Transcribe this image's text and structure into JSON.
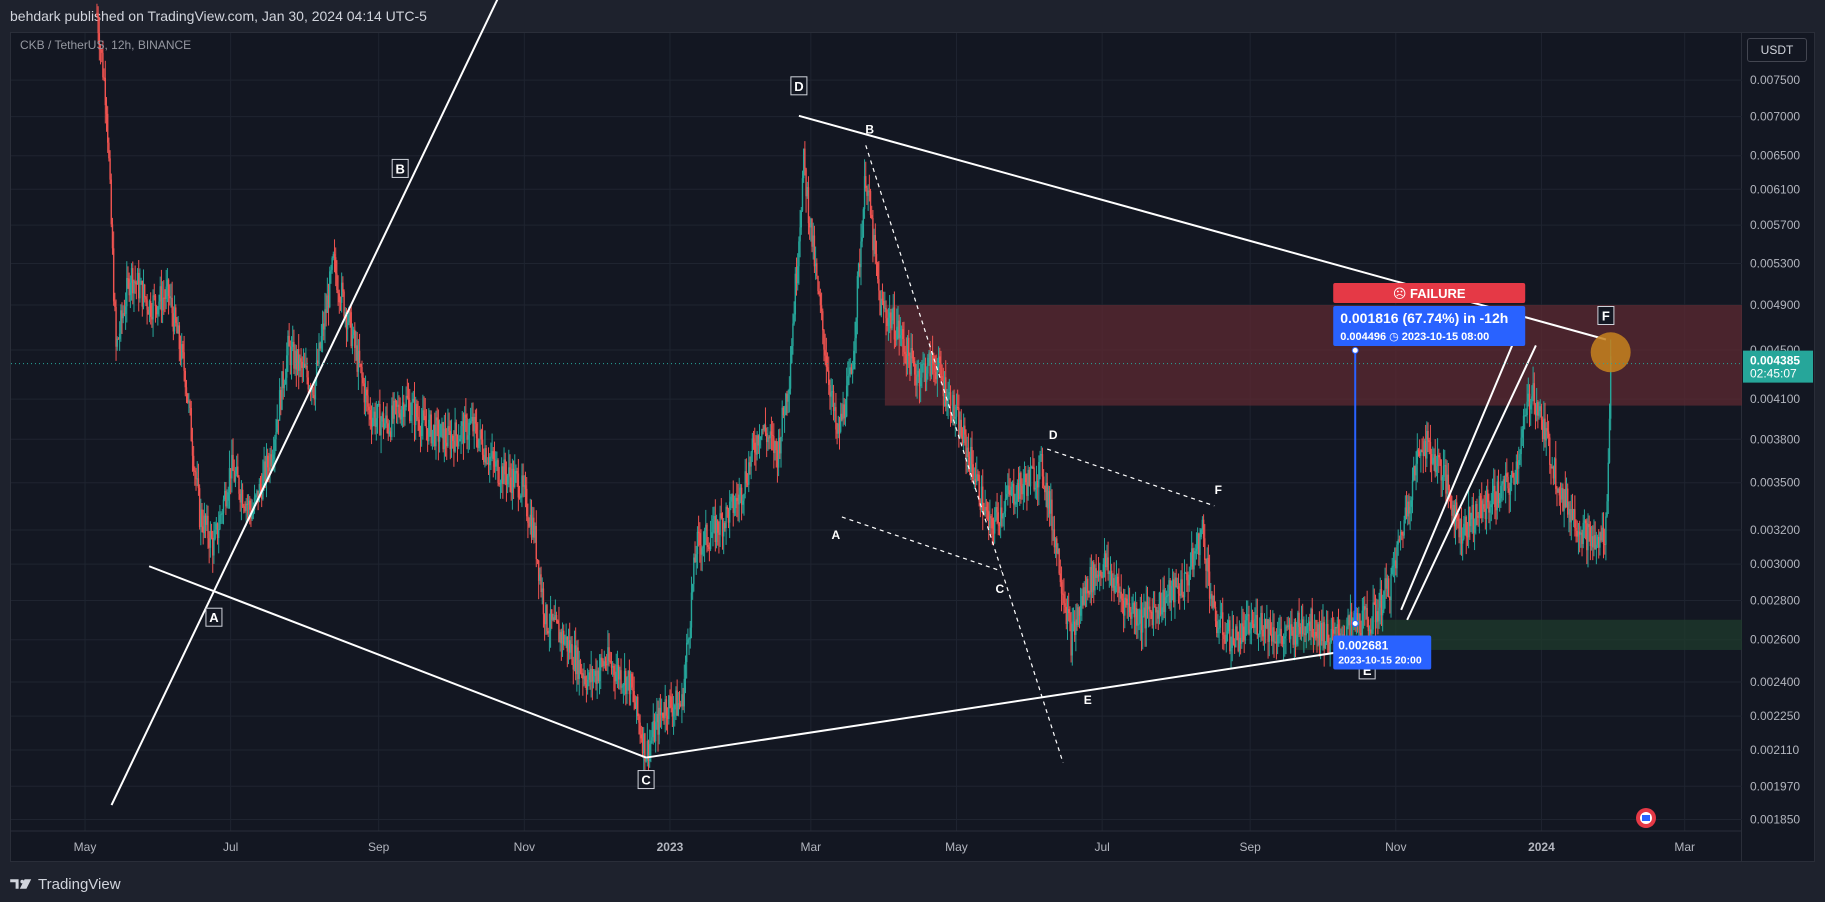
{
  "header": {
    "published_text": "behdark published on TradingView.com, Jan 30, 2024 04:14 UTC-5"
  },
  "footer": {
    "brand": "TradingView"
  },
  "symbol": {
    "label": "CKB / TetherUS, 12h, BINANCE",
    "currency": "USDT"
  },
  "colors": {
    "background": "#131722",
    "up_candle": "#26a69a",
    "down_candle": "#ef5350",
    "pattern_line": "#ffffff",
    "resistance_zone": "#5d2a32",
    "support_zone": "#1f3b2c",
    "measure_blue": "#2962ff",
    "failure_red": "#e53946",
    "current_price_bg": "#26a69a",
    "marker_orange": "#c7821e"
  },
  "chart_data": {
    "type": "candlestick",
    "symbol": "CKB / TetherUS",
    "interval": "12h",
    "exchange": "BINANCE",
    "x_ticks": [
      "May",
      "Jul",
      "Sep",
      "Nov",
      "2023",
      "Mar",
      "May",
      "Jul",
      "Sep",
      "Nov",
      "2024",
      "Mar"
    ],
    "y_ticks": [
      "0.007500",
      "0.007000",
      "0.006500",
      "0.006100",
      "0.005700",
      "0.005300",
      "0.004900",
      "0.004500",
      "0.004100",
      "0.003800",
      "0.003500",
      "0.003200",
      "0.003000",
      "0.002800",
      "0.002600",
      "0.002400",
      "0.002250",
      "0.002110",
      "0.001970",
      "0.001850"
    ],
    "log_scale": true,
    "current_price": "0.004385",
    "countdown": "02:45:07",
    "price_series": {
      "name": "CKB/USDT close (approx.)",
      "points": [
        [
          "2022-05-06",
          0.0085
        ],
        [
          "2022-05-10",
          0.0072
        ],
        [
          "2022-05-14",
          0.0045
        ],
        [
          "2022-05-20",
          0.0052
        ],
        [
          "2022-05-28",
          0.0049
        ],
        [
          "2022-06-05",
          0.005
        ],
        [
          "2022-06-12",
          0.0043
        ],
        [
          "2022-06-18",
          0.0033
        ],
        [
          "2022-06-24",
          0.0031
        ],
        [
          "2022-07-01",
          0.0036
        ],
        [
          "2022-07-10",
          0.0033
        ],
        [
          "2022-07-18",
          0.0037
        ],
        [
          "2022-07-25",
          0.0045
        ],
        [
          "2022-08-05",
          0.0042
        ],
        [
          "2022-08-13",
          0.0053
        ],
        [
          "2022-08-20",
          0.0047
        ],
        [
          "2022-08-28",
          0.004
        ],
        [
          "2022-09-05",
          0.0039
        ],
        [
          "2022-09-12",
          0.0041
        ],
        [
          "2022-09-20",
          0.0039
        ],
        [
          "2022-09-30",
          0.0038
        ],
        [
          "2022-10-10",
          0.0039
        ],
        [
          "2022-10-20",
          0.0036
        ],
        [
          "2022-10-30",
          0.0035
        ],
        [
          "2022-11-05",
          0.0032
        ],
        [
          "2022-11-10",
          0.0027
        ],
        [
          "2022-11-18",
          0.0026
        ],
        [
          "2022-11-28",
          0.0024
        ],
        [
          "2022-12-05",
          0.0025
        ],
        [
          "2022-12-15",
          0.0024
        ],
        [
          "2022-12-22",
          0.0021
        ],
        [
          "2022-12-30",
          0.0023
        ],
        [
          "2023-01-06",
          0.0023
        ],
        [
          "2023-01-12",
          0.0031
        ],
        [
          "2023-01-20",
          0.0032
        ],
        [
          "2023-01-30",
          0.0034
        ],
        [
          "2023-02-08",
          0.0039
        ],
        [
          "2023-02-15",
          0.0037
        ],
        [
          "2023-02-20",
          0.0043
        ],
        [
          "2023-02-26",
          0.0064
        ],
        [
          "2023-03-04",
          0.005
        ],
        [
          "2023-03-12",
          0.0038
        ],
        [
          "2023-03-18",
          0.0043
        ],
        [
          "2023-03-24",
          0.0063
        ],
        [
          "2023-03-30",
          0.0049
        ],
        [
          "2023-04-06",
          0.0047
        ],
        [
          "2023-04-14",
          0.0043
        ],
        [
          "2023-04-22",
          0.0044
        ],
        [
          "2023-04-30",
          0.004
        ],
        [
          "2023-05-08",
          0.0036
        ],
        [
          "2023-05-15",
          0.0032
        ],
        [
          "2023-05-22",
          0.0034
        ],
        [
          "2023-05-30",
          0.0035
        ],
        [
          "2023-06-06",
          0.0036
        ],
        [
          "2023-06-12",
          0.0031
        ],
        [
          "2023-06-18",
          0.0026
        ],
        [
          "2023-06-25",
          0.0029
        ],
        [
          "2023-07-02",
          0.003
        ],
        [
          "2023-07-10",
          0.0028
        ],
        [
          "2023-07-18",
          0.0027
        ],
        [
          "2023-07-26",
          0.0028
        ],
        [
          "2023-08-05",
          0.0029
        ],
        [
          "2023-08-12",
          0.0032
        ],
        [
          "2023-08-17",
          0.0027
        ],
        [
          "2023-08-25",
          0.0026
        ],
        [
          "2023-09-05",
          0.0027
        ],
        [
          "2023-09-15",
          0.0026
        ],
        [
          "2023-09-25",
          0.0027
        ],
        [
          "2023-10-05",
          0.0026
        ],
        [
          "2023-10-15",
          0.00268
        ],
        [
          "2023-10-22",
          0.0027
        ],
        [
          "2023-10-30",
          0.0029
        ],
        [
          "2023-11-05",
          0.0033
        ],
        [
          "2023-11-12",
          0.0038
        ],
        [
          "2023-11-20",
          0.0036
        ],
        [
          "2023-11-28",
          0.0032
        ],
        [
          "2023-12-05",
          0.0033
        ],
        [
          "2023-12-12",
          0.0034
        ],
        [
          "2023-12-20",
          0.0035
        ],
        [
          "2023-12-28",
          0.0042
        ],
        [
          "2024-01-03",
          0.0038
        ],
        [
          "2024-01-10",
          0.0034
        ],
        [
          "2024-01-18",
          0.0032
        ],
        [
          "2024-01-24",
          0.0031
        ],
        [
          "2024-01-28",
          0.0032
        ],
        [
          "2024-01-30",
          0.004385
        ]
      ]
    },
    "pattern_large": {
      "labels": [
        {
          "text": "A",
          "date": "2022-06-24",
          "price": 0.00285
        },
        {
          "text": "B",
          "date": "2022-09-10",
          "price": 0.00595
        },
        {
          "text": "C",
          "date": "2022-12-22",
          "price": 0.00208
        },
        {
          "text": "D",
          "date": "2023-02-24",
          "price": 0.00701
        },
        {
          "text": "E",
          "date": "2023-10-20",
          "price": 0.00256
        },
        {
          "text": "F",
          "date": "2024-01-28",
          "price": 0.00459
        }
      ]
    },
    "pattern_small": {
      "labels": [
        {
          "text": "A",
          "date": "2023-03-14",
          "price": 0.00328
        },
        {
          "text": "B",
          "date": "2023-03-24",
          "price": 0.00663
        },
        {
          "text": "C",
          "date": "2023-05-20",
          "price": 0.00296
        },
        {
          "text": "D",
          "date": "2023-06-08",
          "price": 0.00373
        },
        {
          "text": "E",
          "date": "2023-06-25",
          "price": 0.0024
        },
        {
          "text": "F",
          "date": "2023-08-17",
          "price": 0.00335
        }
      ]
    },
    "measure": {
      "change_text": "0.001816 (67.74%) in -12h",
      "top_price_text": "0.004496",
      "top_time_text": "2023-10-15  08:00",
      "bottom_price_text": "0.002681",
      "bottom_time_text": "2023-10-15 20:00"
    },
    "failure_label": "FAILURE",
    "zones": [
      {
        "name": "resistance",
        "low": 0.00405,
        "high": 0.0049,
        "from": "2023-04-01"
      },
      {
        "name": "support",
        "low": 0.00255,
        "high": 0.0027,
        "from": "2023-09-20"
      }
    ]
  }
}
